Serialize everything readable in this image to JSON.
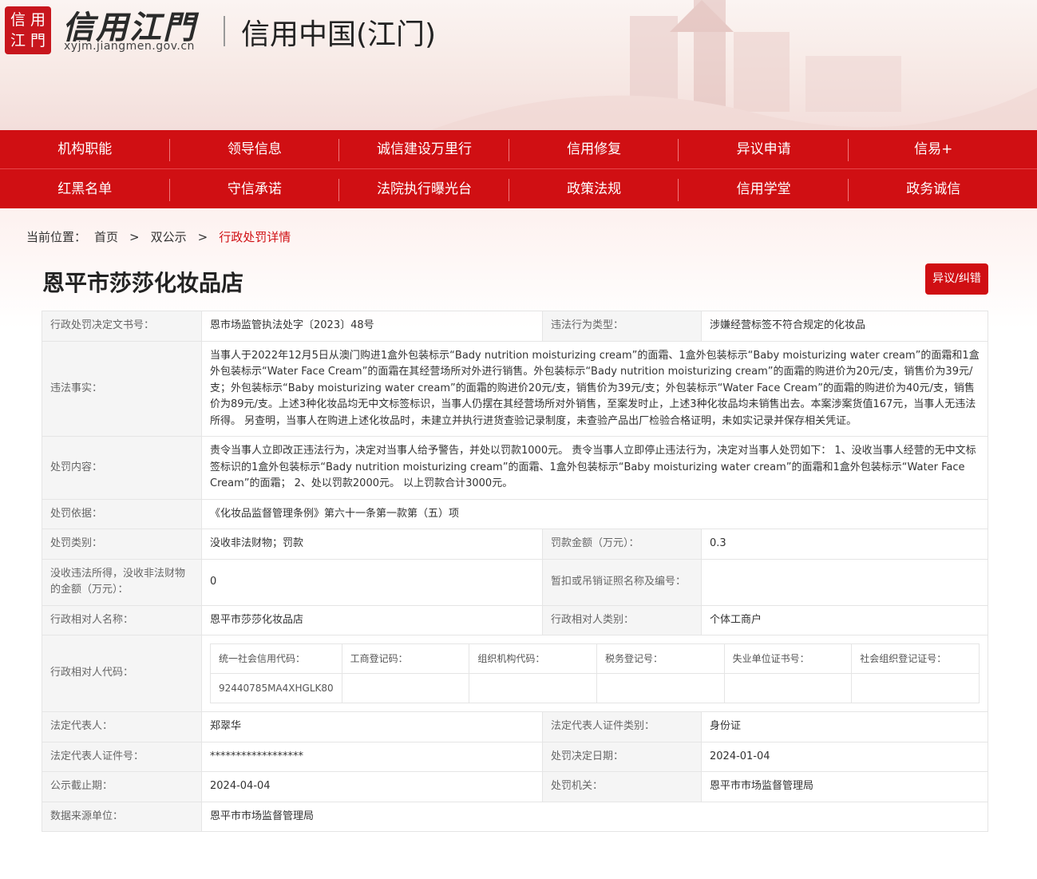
{
  "header": {
    "seal_chars": [
      "信",
      "用",
      "江",
      "門"
    ],
    "logo_title": "信用江門",
    "logo_url": "xyjm.jiangmen.gov.cn",
    "site_name": "信用中国(江门)"
  },
  "nav": {
    "row1": [
      "机构职能",
      "领导信息",
      "诚信建设万里行",
      "信用修复",
      "异议申请",
      "信易+"
    ],
    "row2": [
      "红黑名单",
      "守信承诺",
      "法院执行曝光台",
      "政策法规",
      "信用学堂",
      "政务诚信"
    ]
  },
  "breadcrumb": {
    "label": "当前位置：",
    "home": "首页",
    "sep1": ">",
    "section": "双公示",
    "sep2": ">",
    "current": "行政处罚详情"
  },
  "page_title": "恩平市莎莎化妆品店",
  "objection_button": "异议/纠错",
  "detail": {
    "doc_no_label": "行政处罚决定文书号：",
    "doc_no": "恩市场监管执法处字〔2023〕48号",
    "violation_type_label": "违法行为类型：",
    "violation_type": "涉嫌经营标签不符合规定的化妆品",
    "facts_label": "违法事实：",
    "facts": "当事人于2022年12月5日从澳门购进1盒外包装标示“Bady nutrition moisturizing cream”的面霜、1盒外包装标示“Baby moisturizing water cream”的面霜和1盒外包装标示“Water Face Cream”的面霜在其经营场所对外进行销售。外包装标示“Bady nutrition moisturizing cream”的面霜的购进价为20元/支，销售价为39元/支；外包装标示“Baby moisturizing water cream”的面霜的购进价20元/支，销售价为39元/支；外包装标示“Water Face Cream”的面霜的购进价为40元/支，销售价为89元/支。上述3种化妆品均无中文标签标识，当事人仍摆在其经营场所对外销售，至案发时止，上述3种化妆品均未销售出去。本案涉案货值167元，当事人无违法所得。 另查明，当事人在购进上述化妆品时，未建立并执行进货查验记录制度，未查验产品出厂检验合格证明，未如实记录并保存相关凭证。",
    "content_label": "处罚内容：",
    "content": "责令当事人立即改正违法行为，决定对当事人给予警告，并处以罚款1000元。 责令当事人立即停止违法行为，决定对当事人处罚如下： 1、没收当事人经营的无中文标签标识的1盒外包装标示“Bady nutrition moisturizing cream”的面霜、1盒外包装标示“Baby moisturizing water cream”的面霜和1盒外包装标示“Water Face Cream”的面霜； 2、处以罚款2000元。 以上罚款合计3000元。",
    "basis_label": "处罚依据：",
    "basis": "《化妆品监督管理条例》第六十一条第一款第（五）项",
    "category_label": "处罚类别：",
    "category": "没收非法财物；罚款",
    "fine_label": "罚款金额（万元）：",
    "fine": "0.3",
    "confiscate_label": "没收违法所得，没收非法财物的金额（万元）：",
    "confiscate": "0",
    "license_label": "暂扣或吊销证照名称及编号：",
    "license": "",
    "party_name_label": "行政相对人名称：",
    "party_name": "恩平市莎莎化妆品店",
    "party_type_label": "行政相对人类别：",
    "party_type": "个体工商户",
    "party_code_label": "行政相对人代码：",
    "code_headers": [
      "统一社会信用代码：",
      "工商登记码：",
      "组织机构代码：",
      "税务登记号：",
      "失业单位证书号：",
      "社会组织登记证号："
    ],
    "code_values": [
      "92440785MA4XHGLK80",
      "",
      "",
      "",
      "",
      ""
    ],
    "legal_rep_label": "法定代表人：",
    "legal_rep": "郑翠华",
    "id_type_label": "法定代表人证件类别：",
    "id_type": "身份证",
    "id_no_label": "法定代表人证件号：",
    "id_no": "******************",
    "decision_date_label": "处罚决定日期：",
    "decision_date": "2024-01-04",
    "deadline_label": "公示截止期：",
    "deadline": "2024-04-04",
    "authority_label": "处罚机关：",
    "authority": "恩平市市场监督管理局",
    "source_label": "数据来源单位：",
    "source": "恩平市市场监督管理局"
  }
}
